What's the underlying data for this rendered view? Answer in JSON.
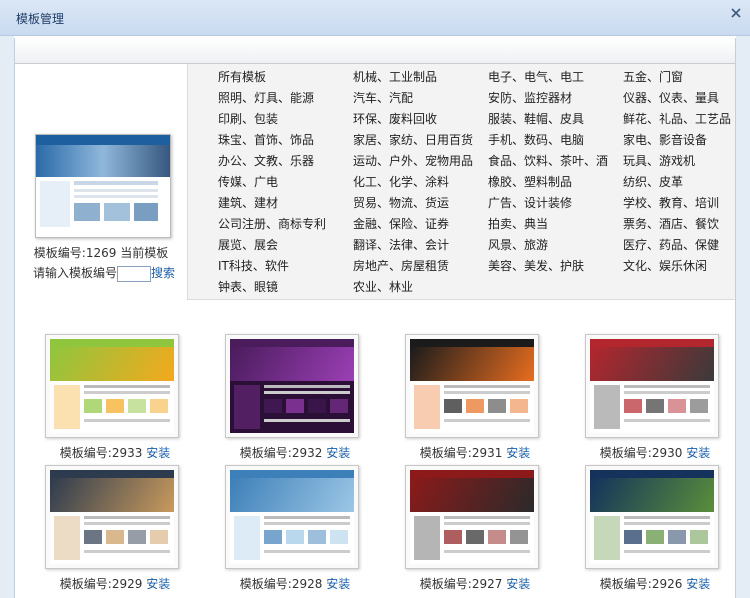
{
  "window": {
    "title": "模板管理"
  },
  "current": {
    "label": "模板编号:1269  当前模板",
    "input_prompt": "请输入模板编号",
    "input_value": "",
    "search_label": "搜索"
  },
  "categories": [
    "所有模板",
    "机械、工业制品",
    "电子、电气、电工",
    "五金、门窗",
    "照明、灯具、能源",
    "汽车、汽配",
    "安防、监控器材",
    "仪器、仪表、量具",
    "印刷、包装",
    "环保、废料回收",
    "服装、鞋帽、皮具",
    "鲜花、礼品、工艺品",
    "珠宝、首饰、饰品",
    "家居、家纺、日用百货",
    "手机、数码、电脑",
    "家电、影音设备",
    "办公、文教、乐器",
    "运动、户外、宠物用品",
    "食品、饮料、茶叶、酒",
    "玩具、游戏机",
    "传媒、广电",
    "化工、化学、涂料",
    "橡胶、塑料制品",
    "纺织、皮革",
    "建筑、建材",
    "贸易、物流、货运",
    "广告、设计装修",
    "学校、教育、培训",
    "公司注册、商标专利",
    "金融、保险、证券",
    "拍卖、典当",
    "票务、酒店、餐饮",
    "展览、展会",
    "翻译、法律、会计",
    "风景、旅游",
    "医疗、药品、保健",
    "IT科技、软件",
    "房地产、房屋租赁",
    "美容、美发、护肤",
    "文化、娱乐休闲",
    "钟表、眼镜",
    "农业、林业"
  ],
  "templates": [
    {
      "label": "模板编号:2933",
      "install": "安装",
      "palette": [
        "#8fc63e",
        "#f4a81d",
        "#ffffff"
      ]
    },
    {
      "label": "模板编号:2932",
      "install": "安装",
      "palette": [
        "#4a1c5c",
        "#9b3fb5",
        "#2b0f36"
      ]
    },
    {
      "label": "模板编号:2931",
      "install": "安装",
      "palette": [
        "#1b1b1b",
        "#e86d1f",
        "#ffffff"
      ]
    },
    {
      "label": "模板编号:2930",
      "install": "安装",
      "palette": [
        "#b3262e",
        "#3a3a3a",
        "#ffffff"
      ]
    },
    {
      "label": "模板编号:2929",
      "install": "安装",
      "palette": [
        "#2d3b4e",
        "#c99a5c",
        "#ffffff"
      ]
    },
    {
      "label": "模板编号:2928",
      "install": "安装",
      "palette": [
        "#3d7fb8",
        "#9cc7e6",
        "#ffffff"
      ]
    },
    {
      "label": "模板编号:2927",
      "install": "安装",
      "palette": [
        "#8c1a1a",
        "#2a2a2a",
        "#ffffff"
      ]
    },
    {
      "label": "模板编号:2926",
      "install": "安装",
      "palette": [
        "#14325c",
        "#5a8f3a",
        "#ffffff"
      ]
    }
  ],
  "colors": {
    "link": "#1a5fa8",
    "titlebar": "#c9daf0"
  }
}
